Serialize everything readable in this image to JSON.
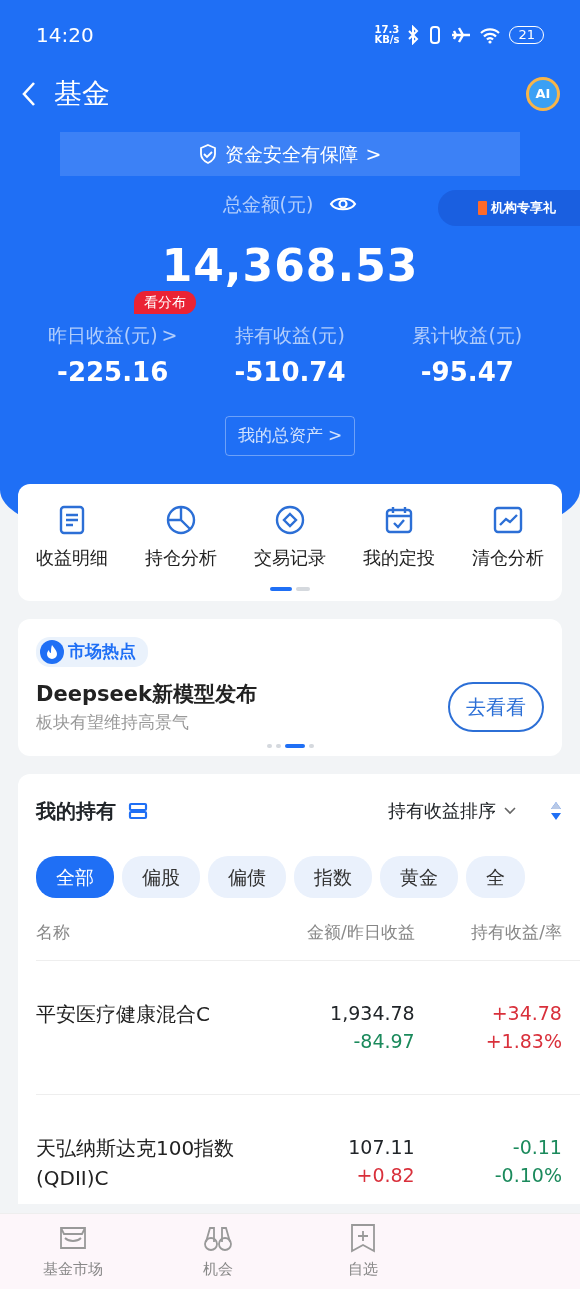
{
  "status_bar": {
    "time": "14:20",
    "speed": "17.3",
    "speed_unit": "KB/s",
    "battery": "21"
  },
  "nav": {
    "title": "基金",
    "ai_badge": "AI"
  },
  "safety_banner": {
    "text": "资金安全有保障",
    "chevron": ">"
  },
  "total": {
    "label": "总金额(元)",
    "amount": "14,368.53",
    "promo": "机构专享礼"
  },
  "stats": [
    {
      "label": "昨日收益(元)",
      "chevron": ">",
      "value": "-225.16",
      "tag": "看分布"
    },
    {
      "label": "持有收益(元)",
      "value": "-510.74"
    },
    {
      "label": "累计收益(元)",
      "value": "-95.47"
    }
  ],
  "assets_button": {
    "label": "我的总资产",
    "chevron": ">"
  },
  "shortcuts": [
    {
      "label": "收益明细",
      "kind": "doc"
    },
    {
      "label": "持仓分析",
      "kind": "pie"
    },
    {
      "label": "交易记录",
      "kind": "diamond"
    },
    {
      "label": "我的定投",
      "kind": "calendar"
    },
    {
      "label": "清仓分析",
      "kind": "chart"
    }
  ],
  "shortcut_pager": [
    {
      "selected": true
    },
    {
      "selected": false
    }
  ],
  "hotspot": {
    "tag": "市场热点",
    "title": "Deepseek新模型发布",
    "subtitle": "板块有望维持高景气",
    "button": "去看看",
    "pager": [
      {
        "selected": false
      },
      {
        "selected": false
      },
      {
        "selected": true
      },
      {
        "selected": false
      }
    ]
  },
  "holdings": {
    "title": "我的持有",
    "sort": "持有收益排序",
    "filters": [
      {
        "label": "全部",
        "selected": true
      },
      {
        "label": "偏股",
        "selected": false
      },
      {
        "label": "偏债",
        "selected": false
      },
      {
        "label": "指数",
        "selected": false
      },
      {
        "label": "黄金",
        "selected": false
      },
      {
        "label": "全",
        "selected": false
      }
    ],
    "columns": [
      "名称",
      "金额/昨日收益",
      "持有收益/率"
    ],
    "rows": [
      {
        "name": "平安医疗健康混合C",
        "amount": "1,934.78",
        "daily": {
          "text": "-84.97",
          "color": "#1b8a5c"
        },
        "profit": {
          "text": "+34.78",
          "color": "#d9303b"
        },
        "rate": {
          "text": "+1.83%",
          "color": "#d9303b"
        }
      },
      {
        "name": "天弘纳斯达克100指数(QDII)C",
        "amount": "107.11",
        "daily": {
          "text": "+0.82",
          "color": "#d9303b"
        },
        "profit": {
          "text": "-0.11",
          "color": "#1b8a5c"
        },
        "rate": {
          "text": "-0.10%",
          "color": "#1b8a5c"
        }
      }
    ]
  },
  "tab_bar": [
    {
      "label": "基金市场",
      "kind": "store"
    },
    {
      "label": "机会",
      "kind": "binoculars"
    },
    {
      "label": "自选",
      "kind": "bookmark"
    }
  ]
}
